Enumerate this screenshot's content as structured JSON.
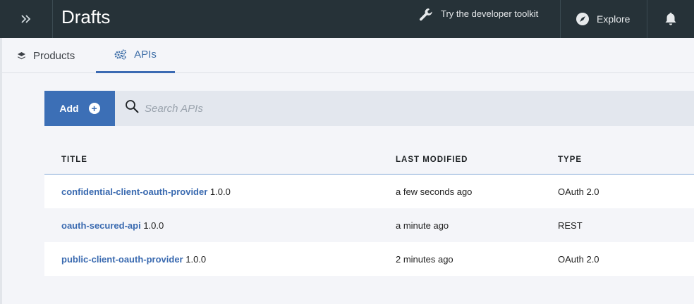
{
  "header": {
    "title": "Drafts",
    "toolkit_label": "Try the developer toolkit",
    "explore_label": "Explore"
  },
  "tabs": [
    {
      "label": "Products",
      "icon": "layers-icon",
      "active": false
    },
    {
      "label": "APIs",
      "icon": "gears-icon",
      "active": true
    }
  ],
  "toolbar": {
    "add_label": "Add",
    "search_placeholder": "Search APIs"
  },
  "table": {
    "columns": [
      "TITLE",
      "LAST MODIFIED",
      "TYPE"
    ],
    "rows": [
      {
        "name": "confidential-client-oauth-provider",
        "version": "1.0.0",
        "modified": "a few seconds ago",
        "type": "OAuth 2.0"
      },
      {
        "name": "oauth-secured-api",
        "version": "1.0.0",
        "modified": "a minute ago",
        "type": "REST"
      },
      {
        "name": "public-client-oauth-provider",
        "version": "1.0.0",
        "modified": "2 minutes ago",
        "type": "OAuth 2.0"
      }
    ]
  },
  "colors": {
    "topbar": "#263238",
    "accent": "#3c6fb6",
    "link": "#3a6ab0"
  }
}
